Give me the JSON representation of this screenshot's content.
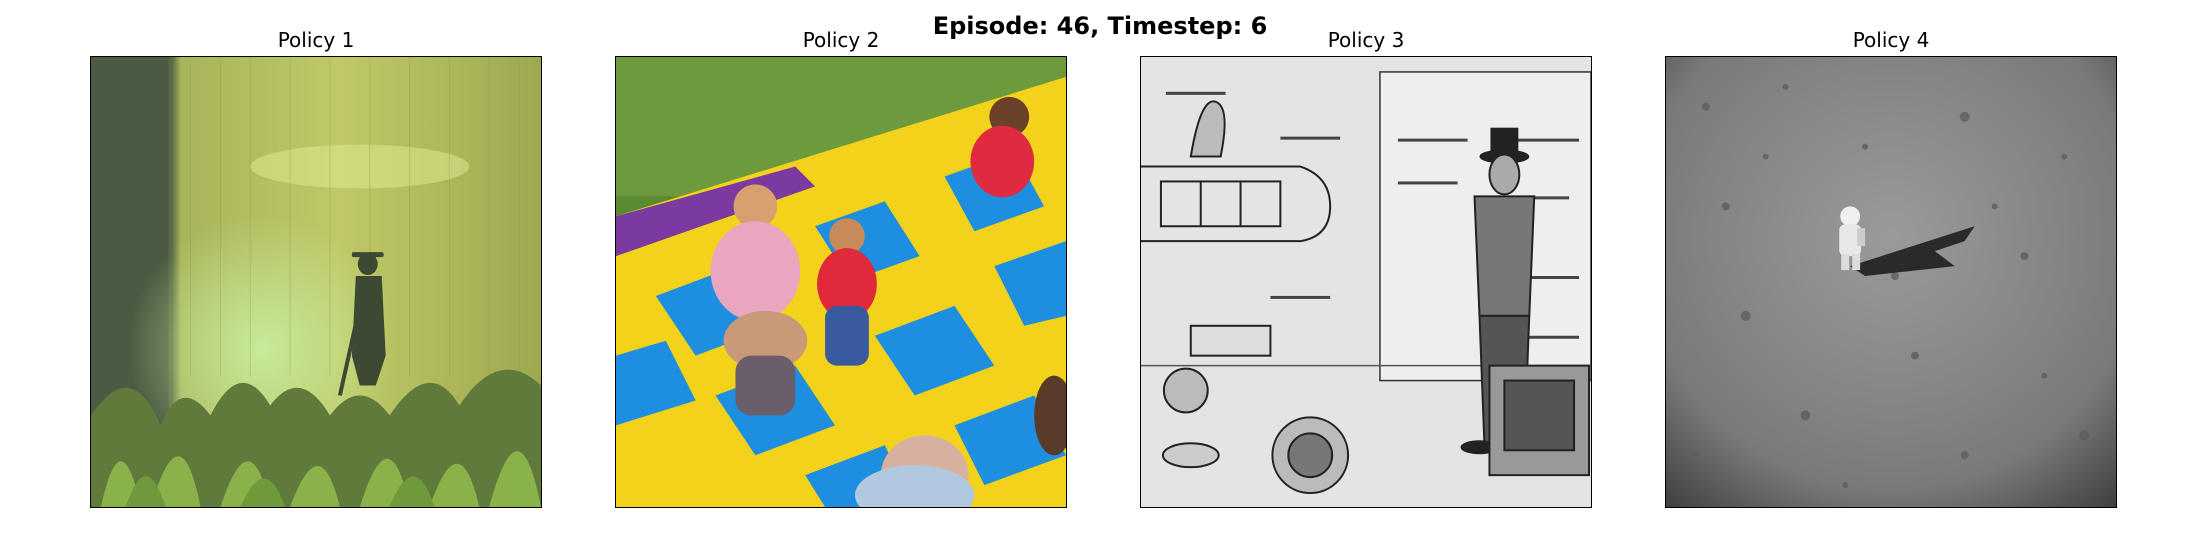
{
  "figure": {
    "suptitle": "Episode: 46, Timestep: 6",
    "panels": [
      {
        "title": "Policy 1",
        "image": "silhouette-figure-in-green-jungle"
      },
      {
        "title": "Policy 2",
        "image": "children-playing-on-colorful-mat"
      },
      {
        "title": "Policy 3",
        "image": "sketch-of-man-with-machinery"
      },
      {
        "title": "Policy 4",
        "image": "astronaut-on-lunar-surface"
      }
    ]
  }
}
